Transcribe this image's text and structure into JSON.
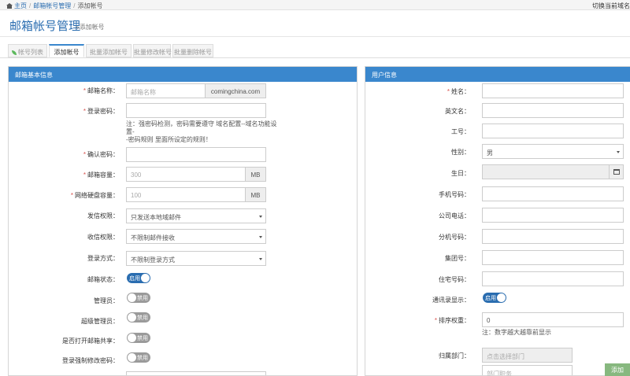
{
  "topbar": {
    "breadcrumbs": [
      "主页",
      "邮箱帐号管理",
      "添加帐号"
    ],
    "right_link": "切换当前域名"
  },
  "header": {
    "title": "邮箱帐号管理",
    "subtitle": "»添加帐号"
  },
  "tabs": [
    "帐号列表",
    "添加帐号",
    "批量添加帐号",
    "批量修改帐号",
    "批量删除帐号"
  ],
  "left_panel": {
    "title": "邮箱基本信息",
    "fields": {
      "mailbox_name": {
        "label": "邮箱名称：",
        "placeholder": "邮箱名称",
        "domain": "comingchina.com"
      },
      "login_password": {
        "label": "登录密码：",
        "note_line1": "注：强密码检测，密码需要遵守 域名配置--域名功能设置-",
        "note_line2": "-密码规则 里面所设定的规则！"
      },
      "confirm_password": {
        "label": "确认密码："
      },
      "mailbox_capacity": {
        "label": "邮箱容量：",
        "value": "300",
        "unit": "MB"
      },
      "disk_capacity": {
        "label": "网络硬盘容量：",
        "value": "100",
        "unit": "MB"
      },
      "send_permission": {
        "label": "发信权限：",
        "value": "只发送本地域邮件"
      },
      "receive_permission": {
        "label": "收信权限：",
        "value": "不限制邮件接收"
      },
      "login_method": {
        "label": "登录方式：",
        "value": "不限制登录方式"
      },
      "mailbox_status": {
        "label": "邮箱状态：",
        "state": "启用"
      },
      "admin": {
        "label": "管理员：",
        "state": "禁用"
      },
      "super_admin": {
        "label": "超级管理员：",
        "state": "禁用"
      },
      "mailbox_share": {
        "label": "是否打开邮箱共享：",
        "state": "禁用"
      },
      "force_change_pwd": {
        "label": "登录强制修改密码：",
        "state": "禁用"
      }
    }
  },
  "right_panel": {
    "title": "用户信息",
    "fields": {
      "name": {
        "label": "姓名："
      },
      "english_name": {
        "label": "英文名："
      },
      "employee_no": {
        "label": "工号："
      },
      "gender": {
        "label": "性别：",
        "value": "男"
      },
      "birthday": {
        "label": "生日："
      },
      "mobile": {
        "label": "手机号码："
      },
      "company_phone": {
        "label": "公司电话："
      },
      "extension": {
        "label": "分机号码："
      },
      "group_no": {
        "label": "集团号："
      },
      "home_phone": {
        "label": "住宅号码："
      },
      "addressbook_display": {
        "label": "通讯录显示：",
        "state": "启用"
      },
      "sort_weight": {
        "label": "排序权重：",
        "value": "0",
        "note": "注：数字越大越靠前显示"
      },
      "department": {
        "label": "归属部门：",
        "placeholder": "点击选择部门",
        "position_placeholder": "部门职务"
      }
    }
  },
  "actions": {
    "add": "添加"
  },
  "colors": {
    "accent": "#3a87cd",
    "title": "#2a6db0",
    "required": "#d9534f",
    "add_button": "#87b87f"
  }
}
